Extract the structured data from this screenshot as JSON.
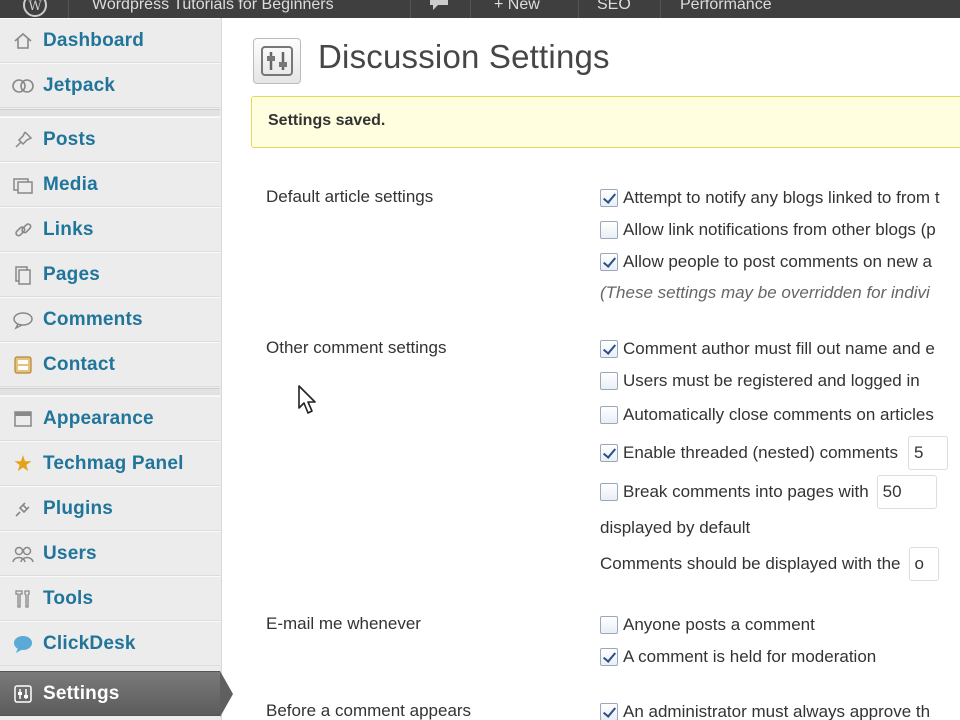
{
  "admin_bar": {
    "site_title": "Wordpress Tutorials for Beginners",
    "new_label": "+ New",
    "seo_label": "SEO",
    "performance_label": "Performance"
  },
  "sidebar": {
    "items": [
      {
        "label": "Dashboard",
        "icon": "home-icon"
      },
      {
        "label": "Jetpack",
        "icon": "jetpack-icon"
      },
      {
        "label": "Posts",
        "icon": "pin-icon"
      },
      {
        "label": "Media",
        "icon": "media-icon"
      },
      {
        "label": "Links",
        "icon": "link-icon"
      },
      {
        "label": "Pages",
        "icon": "pages-icon"
      },
      {
        "label": "Comments",
        "icon": "comment-icon"
      },
      {
        "label": "Contact",
        "icon": "contact-icon"
      },
      {
        "label": "Appearance",
        "icon": "appearance-icon"
      },
      {
        "label": "Techmag Panel",
        "icon": "star-icon"
      },
      {
        "label": "Plugins",
        "icon": "plug-icon"
      },
      {
        "label": "Users",
        "icon": "users-icon"
      },
      {
        "label": "Tools",
        "icon": "tools-icon"
      },
      {
        "label": "ClickDesk",
        "icon": "chat-icon"
      },
      {
        "label": "Settings",
        "icon": "settings-icon"
      }
    ],
    "current": "Settings"
  },
  "page": {
    "title": "Discussion Settings",
    "notice": "Settings saved."
  },
  "sections": {
    "default_article": {
      "label": "Default article settings",
      "options": [
        {
          "text": "Attempt to notify any blogs linked to from t",
          "checked": true
        },
        {
          "text": "Allow link notifications from other blogs (p",
          "checked": false
        },
        {
          "text": "Allow people to post comments on new a",
          "checked": true
        }
      ],
      "note": "(These settings may be overridden for indivi"
    },
    "other_comment": {
      "label": "Other comment settings",
      "options": [
        {
          "text": "Comment author must fill out name and e",
          "checked": true
        },
        {
          "text": "Users must be registered and logged in",
          "checked": false
        },
        {
          "text": "Automatically close comments on articles",
          "checked": false
        },
        {
          "text": "Enable threaded (nested) comments",
          "checked": true,
          "input_value": "5"
        },
        {
          "text": "Break comments into pages with",
          "checked": false,
          "input_value": "50"
        }
      ],
      "displayed_default": "displayed by default",
      "display_with": "Comments should be displayed with the",
      "display_with_value": "o"
    },
    "email_me": {
      "label": "E-mail me whenever",
      "options": [
        {
          "text": "Anyone posts a comment",
          "checked": false
        },
        {
          "text": "A comment is held for moderation",
          "checked": true
        }
      ]
    },
    "before_comment": {
      "label": "Before a comment appears",
      "options": [
        {
          "text": "An administrator must always approve th",
          "checked": true
        }
      ]
    }
  },
  "colors": {
    "link": "#21759b",
    "admin_bar": "#3f3f3f",
    "notice_bg": "#ffffe0",
    "notice_border": "#e6db55"
  }
}
